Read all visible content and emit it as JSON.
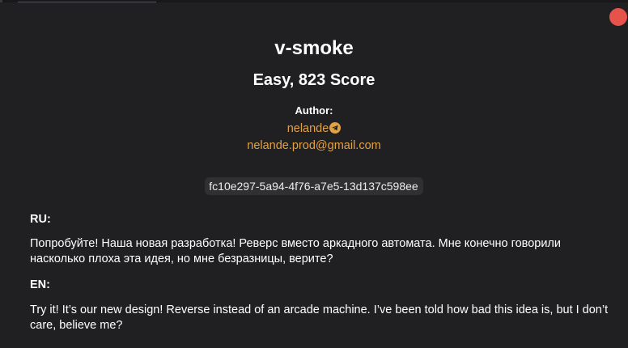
{
  "challenge": {
    "title": "v-smoke",
    "subtitle": "Easy, 823 Score"
  },
  "author": {
    "label": "Author:",
    "name": "nelande",
    "name_icon": "telegram-icon",
    "email": "nelande.prod@gmail.com"
  },
  "task_id": "fc10e297-5a94-4f76-a7e5-13d137c598ee",
  "description": {
    "ru_label": "RU:",
    "ru_text": "Попробуйте! Наша новая разработка! Реверс вместо аркадного автомата. Мне конечно говорили насколько плоха эта идея, но мне безразницы, верите?",
    "en_label": "EN:",
    "en_text": "Try it! It’s our new design! Reverse instead of an arcade machine. I’ve been told how bad this idea is, but I don’t care, believe me?"
  },
  "colors": {
    "background": "#202023",
    "accent": "#e2a144",
    "close": "#e5534b",
    "id_chip": "#303033"
  }
}
